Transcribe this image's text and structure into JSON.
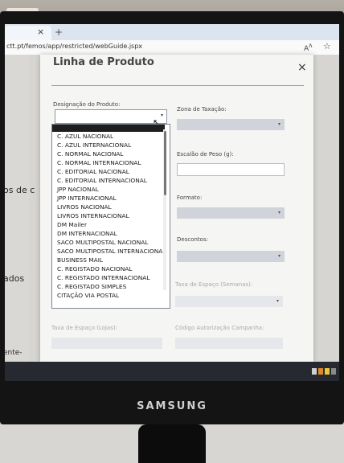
{
  "browser": {
    "tab_close": "×",
    "url": "ctt.pt/femos/app/restricted/webGuide.jspx",
    "reader_icon": "reader-mode-icon",
    "star_icon": "favorite-star-icon"
  },
  "background_page": {
    "fragment_1": "os de c",
    "fragment_2": "ados",
    "fragment_3": "ente-"
  },
  "modal": {
    "title": "Linha de Produto",
    "close": "×",
    "fields": {
      "designacao_label": "Designação do Produto:",
      "zona_label": "Zona de Taxação:",
      "escalao_label": "Escalão de Peso (g):",
      "formato_label": "Formato:",
      "descontos_label": "Descontos:",
      "taxa_semanas_label": "Taxa de Espaço (Semanas):",
      "taxa_lojas_label": "Taxa de Espaço (Lojas):",
      "codigo_label": "Código Autorização Campanha:"
    },
    "dropdown_options": [
      "C. AZUL NACIONAL",
      "C. AZUL INTERNACIONAL",
      "C. NORMAL NACIONAL",
      "C. NORMAL INTERNACIONAL",
      "C. EDITORIAL NACIONAL",
      "C. EDITORIAL INTERNACIONAL",
      "JPP NACIONAL",
      "JPP INTERNACIONAL",
      "LIVROS NACIONAL",
      "LIVROS INTERNACIONAL",
      "DM Mailer",
      "DM INTERNACIONAL",
      "SACO MULTIPOSTAL NACIONAL",
      "SACO MULTIPOSTAL INTERNACIONAL",
      "BUSINESS MAIL",
      "C. REGISTADO NACIONAL",
      "C. REGISTADO INTERNACIONAL",
      "C. REGISTADO SIMPLES",
      "CITAÇÃO VIA POSTAL"
    ]
  },
  "monitor": {
    "brand": "SAMSUNG"
  },
  "colors": {
    "select_fill": "#d0d3d9",
    "selected_option": "#1e1e1e",
    "tray_orange": "#e0892a",
    "tray_yellow": "#e6c83a"
  }
}
